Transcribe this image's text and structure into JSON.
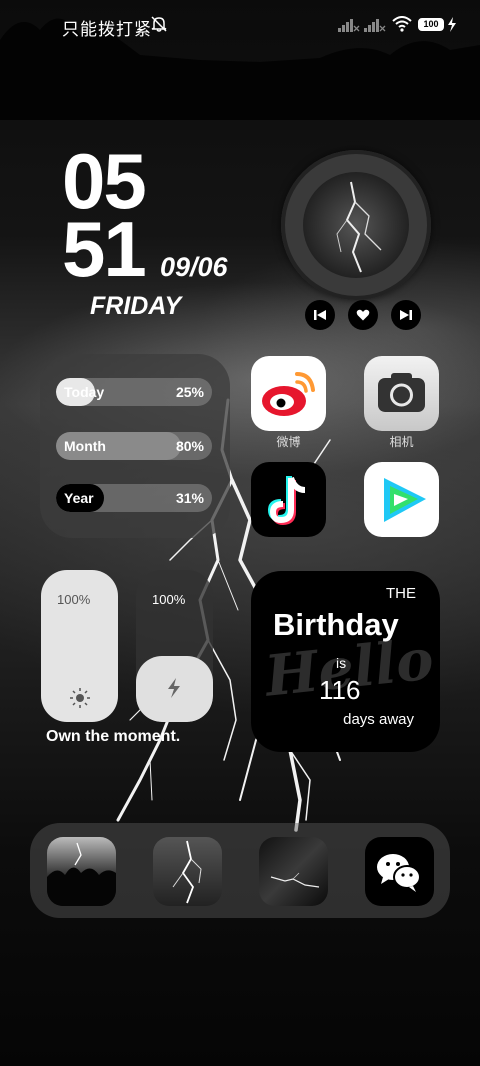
{
  "status_bar": {
    "carrier": "只能拨打紧",
    "battery": "100",
    "icons": [
      "mute-bell-icon",
      "signal-icon",
      "signal-icon",
      "wifi-icon",
      "battery-icon",
      "charging-icon"
    ]
  },
  "clock": {
    "hour": "05",
    "minute": "51",
    "date": "09/06",
    "weekday": "FRIDAY"
  },
  "music_widget": {
    "controls": [
      "previous-icon",
      "heart-icon",
      "next-icon"
    ]
  },
  "progress_widget": {
    "items": [
      {
        "label": "Today",
        "value": "25%",
        "fraction": 0.25
      },
      {
        "label": "Month",
        "value": "80%",
        "fraction": 0.8
      },
      {
        "label": "Year",
        "value": "31%",
        "fraction": 0.31
      }
    ]
  },
  "apps": [
    {
      "name": "微博",
      "icon": "weibo-icon"
    },
    {
      "name": "相机",
      "icon": "camera-icon"
    },
    {
      "name": "",
      "icon": "tiktok-icon"
    },
    {
      "name": "",
      "icon": "tencent-video-icon"
    }
  ],
  "control_widget": {
    "brightness": "100%",
    "battery_saver": "100%",
    "motto": "Own the moment."
  },
  "birthday_widget": {
    "the": "THE",
    "title": "Birthday",
    "is": "is",
    "days": "116",
    "away": "days away",
    "watermark": "Hello"
  },
  "dock": {
    "apps": [
      "photo-storm-icon",
      "photo-lightning-icon",
      "photo-sky-icon",
      "wechat-icon"
    ]
  }
}
